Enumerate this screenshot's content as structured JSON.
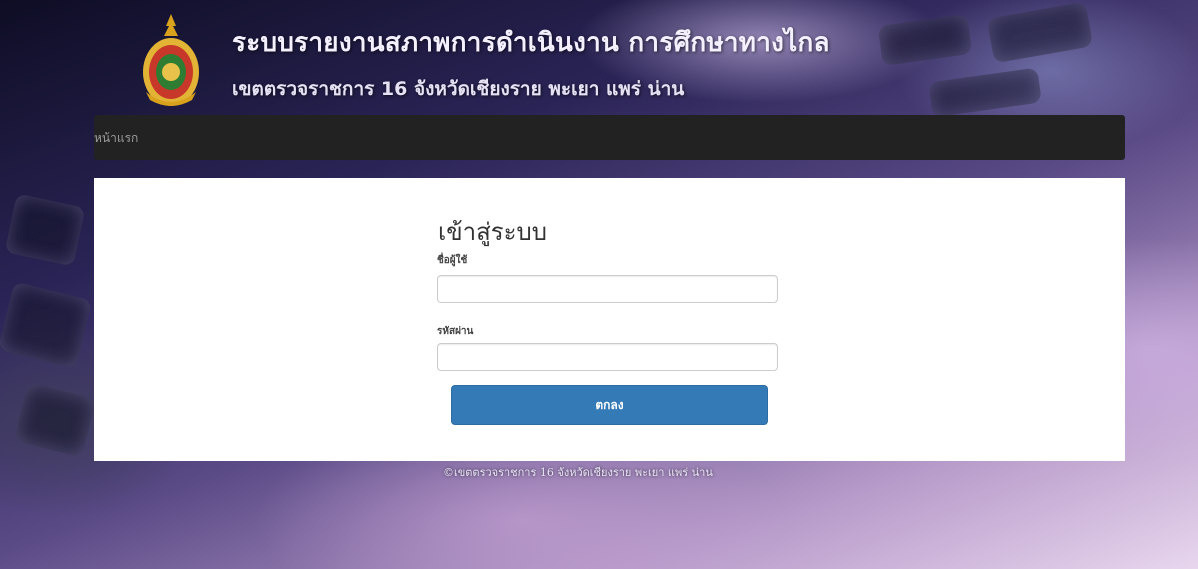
{
  "header": {
    "title": "ระบบรายงานสภาพการดำเนินงาน การศึกษาทางไกล",
    "subtitle": "เขตตรวจราชการ 16 จังหวัดเชียงราย พะเยา แพร่ น่าน",
    "logo_icon": "emblem-logo"
  },
  "navbar": {
    "home_label": "หน้าแรก"
  },
  "login": {
    "title": "เข้าสู่ระบบ",
    "username_label": "ชื่อผู้ใช้",
    "username_value": "",
    "password_label": "รหัสผ่าน",
    "password_value": "",
    "submit_label": "ตกลง"
  },
  "footer": {
    "text": "©เขตตรวจราชการ 16 จังหวัดเชียงราย พะเยา แพร่ น่าน"
  },
  "colors": {
    "navbar_bg": "#222222",
    "button_primary": "#337ab7",
    "panel_bg": "#ffffff"
  }
}
